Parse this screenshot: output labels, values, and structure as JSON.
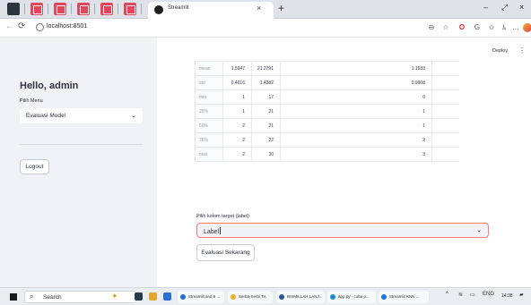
{
  "browser": {
    "tab_title": "Streamlit",
    "tab_close": "×",
    "new_tab": "+",
    "url": "localhost:8501",
    "window_controls": [
      "–",
      "⤢",
      "×"
    ]
  },
  "header": {
    "deploy_label": "Deploy",
    "menu_icon": "⋮"
  },
  "sidebar": {
    "greeting": "Hello, admin",
    "menu_label": "Pilih Menu",
    "menu_value": "Evaluasi Model",
    "logout_label": "Logout"
  },
  "table": {
    "rows": [
      {
        "label": "mean",
        "values": [
          "1.5947",
          "21.2791",
          "1.1933",
          ""
        ]
      },
      {
        "label": "std",
        "values": [
          "0.4916",
          "1.4382",
          "0.9908",
          ""
        ]
      },
      {
        "label": "min",
        "values": [
          "1",
          "17",
          "0",
          ""
        ]
      },
      {
        "label": "25%",
        "values": [
          "1",
          "21",
          "1",
          ""
        ]
      },
      {
        "label": "50%",
        "values": [
          "2",
          "21",
          "1",
          ""
        ]
      },
      {
        "label": "75%",
        "values": [
          "2",
          "22",
          "2",
          ""
        ]
      },
      {
        "label": "max",
        "values": [
          "2",
          "30",
          "3",
          ""
        ]
      }
    ]
  },
  "target": {
    "label": "Pilih kolom target (label)",
    "value": "Label",
    "button_label": "Evaluasi Sekarang"
  },
  "taskbar": {
    "search_placeholder": "Search",
    "items": [
      {
        "label": "Streamlit and 6 ...",
        "icon_color": "#1f6fd1"
      },
      {
        "label": "Serba-Serbi TA",
        "icon_color": "#f2b01e"
      },
      {
        "label": "BISMILLAH LANJ...",
        "icon_color": "#2b5797"
      },
      {
        "label": "app.py - coba p...",
        "icon_color": "#1f8ad2"
      },
      {
        "label": "Streamlit KNN ...",
        "icon_color": "#1a73e8"
      }
    ],
    "tray_lang": "ENG",
    "clock": "14:38"
  }
}
